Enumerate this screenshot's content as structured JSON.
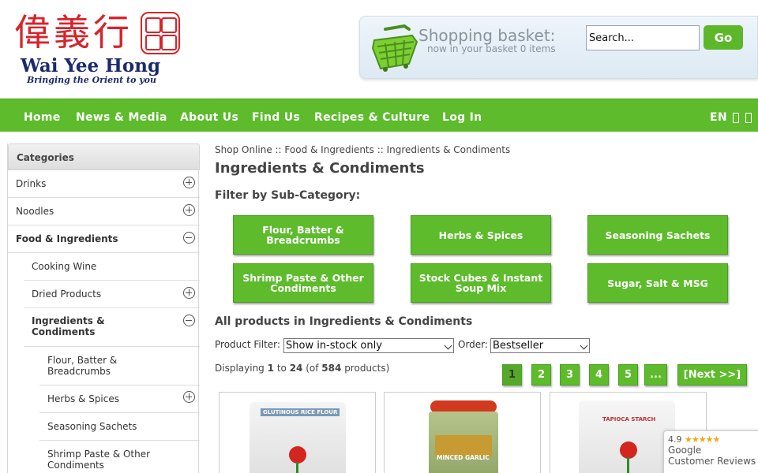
{
  "header": {
    "logo_cjk": "偉義行",
    "logo_brand": "Wai Yee Hong",
    "logo_tagline": "Bringing the Orient to you",
    "basket_title": "Shopping basket:",
    "basket_sub": "now in your basket 0 items",
    "search_placeholder": "Search...",
    "go_label": "Go"
  },
  "nav": {
    "items": [
      "Home",
      "News & Media",
      "About Us",
      "Find Us",
      "Recipes & Culture",
      "Log In"
    ],
    "lang": "EN"
  },
  "sidebar": {
    "title": "Categories",
    "items": [
      {
        "label": "Drinks",
        "toggle": "plus"
      },
      {
        "label": "Noodles",
        "toggle": "plus"
      },
      {
        "label": "Food & Ingredients",
        "toggle": "minus"
      },
      {
        "label": "Cooking Wine"
      },
      {
        "label": "Dried Products",
        "toggle": "plus"
      },
      {
        "label": "Ingredients & Condiments",
        "toggle": "minus"
      },
      {
        "label": "Flour, Batter & Breadcrumbs"
      },
      {
        "label": "Herbs & Spices",
        "toggle": "plus"
      },
      {
        "label": "Seasoning Sachets"
      },
      {
        "label": "Shrimp Paste & Other Condiments"
      }
    ]
  },
  "main": {
    "breadcrumb": "Shop Online ::  Food & Ingredients ::  Ingredients & Condiments",
    "title": "Ingredients & Condiments",
    "filter_label": "Filter by Sub-Category:",
    "subcategories": [
      "Flour, Batter & Breadcrumbs",
      "Herbs & Spices",
      "Seasoning Sachets",
      "Shrimp Paste & Other Condiments",
      "Stock Cubes & Instant Soup Mix",
      "Sugar, Salt & MSG"
    ],
    "all_products": "All products in Ingredients & Condiments",
    "product_filter_label": "Product Filter:",
    "product_filter_value": "Show in-stock only",
    "order_label": "Order:",
    "order_value": "Bestseller",
    "displaying_prefix": "Displaying",
    "displaying_from": "1",
    "displaying_to_word": "to",
    "displaying_to": "24",
    "displaying_of": "(of",
    "displaying_total": "584",
    "displaying_suffix": "products)",
    "pages": [
      "1",
      "2",
      "3",
      "4",
      "5",
      "...",
      "[Next >>]"
    ],
    "products": [
      {
        "label": "GLUTINOUS RICE FLOUR"
      },
      {
        "label": "MINCED GARLIC"
      },
      {
        "label": "TAPIOCA STARCH"
      }
    ]
  },
  "reviews": {
    "rating": "4.9",
    "stars": "★★★★★",
    "line1": "Google",
    "line2": "Customer Reviews"
  },
  "colors": {
    "accent_green": "#5dbb2c",
    "brand_red": "#d8232a",
    "brand_navy": "#1b2a6b"
  }
}
